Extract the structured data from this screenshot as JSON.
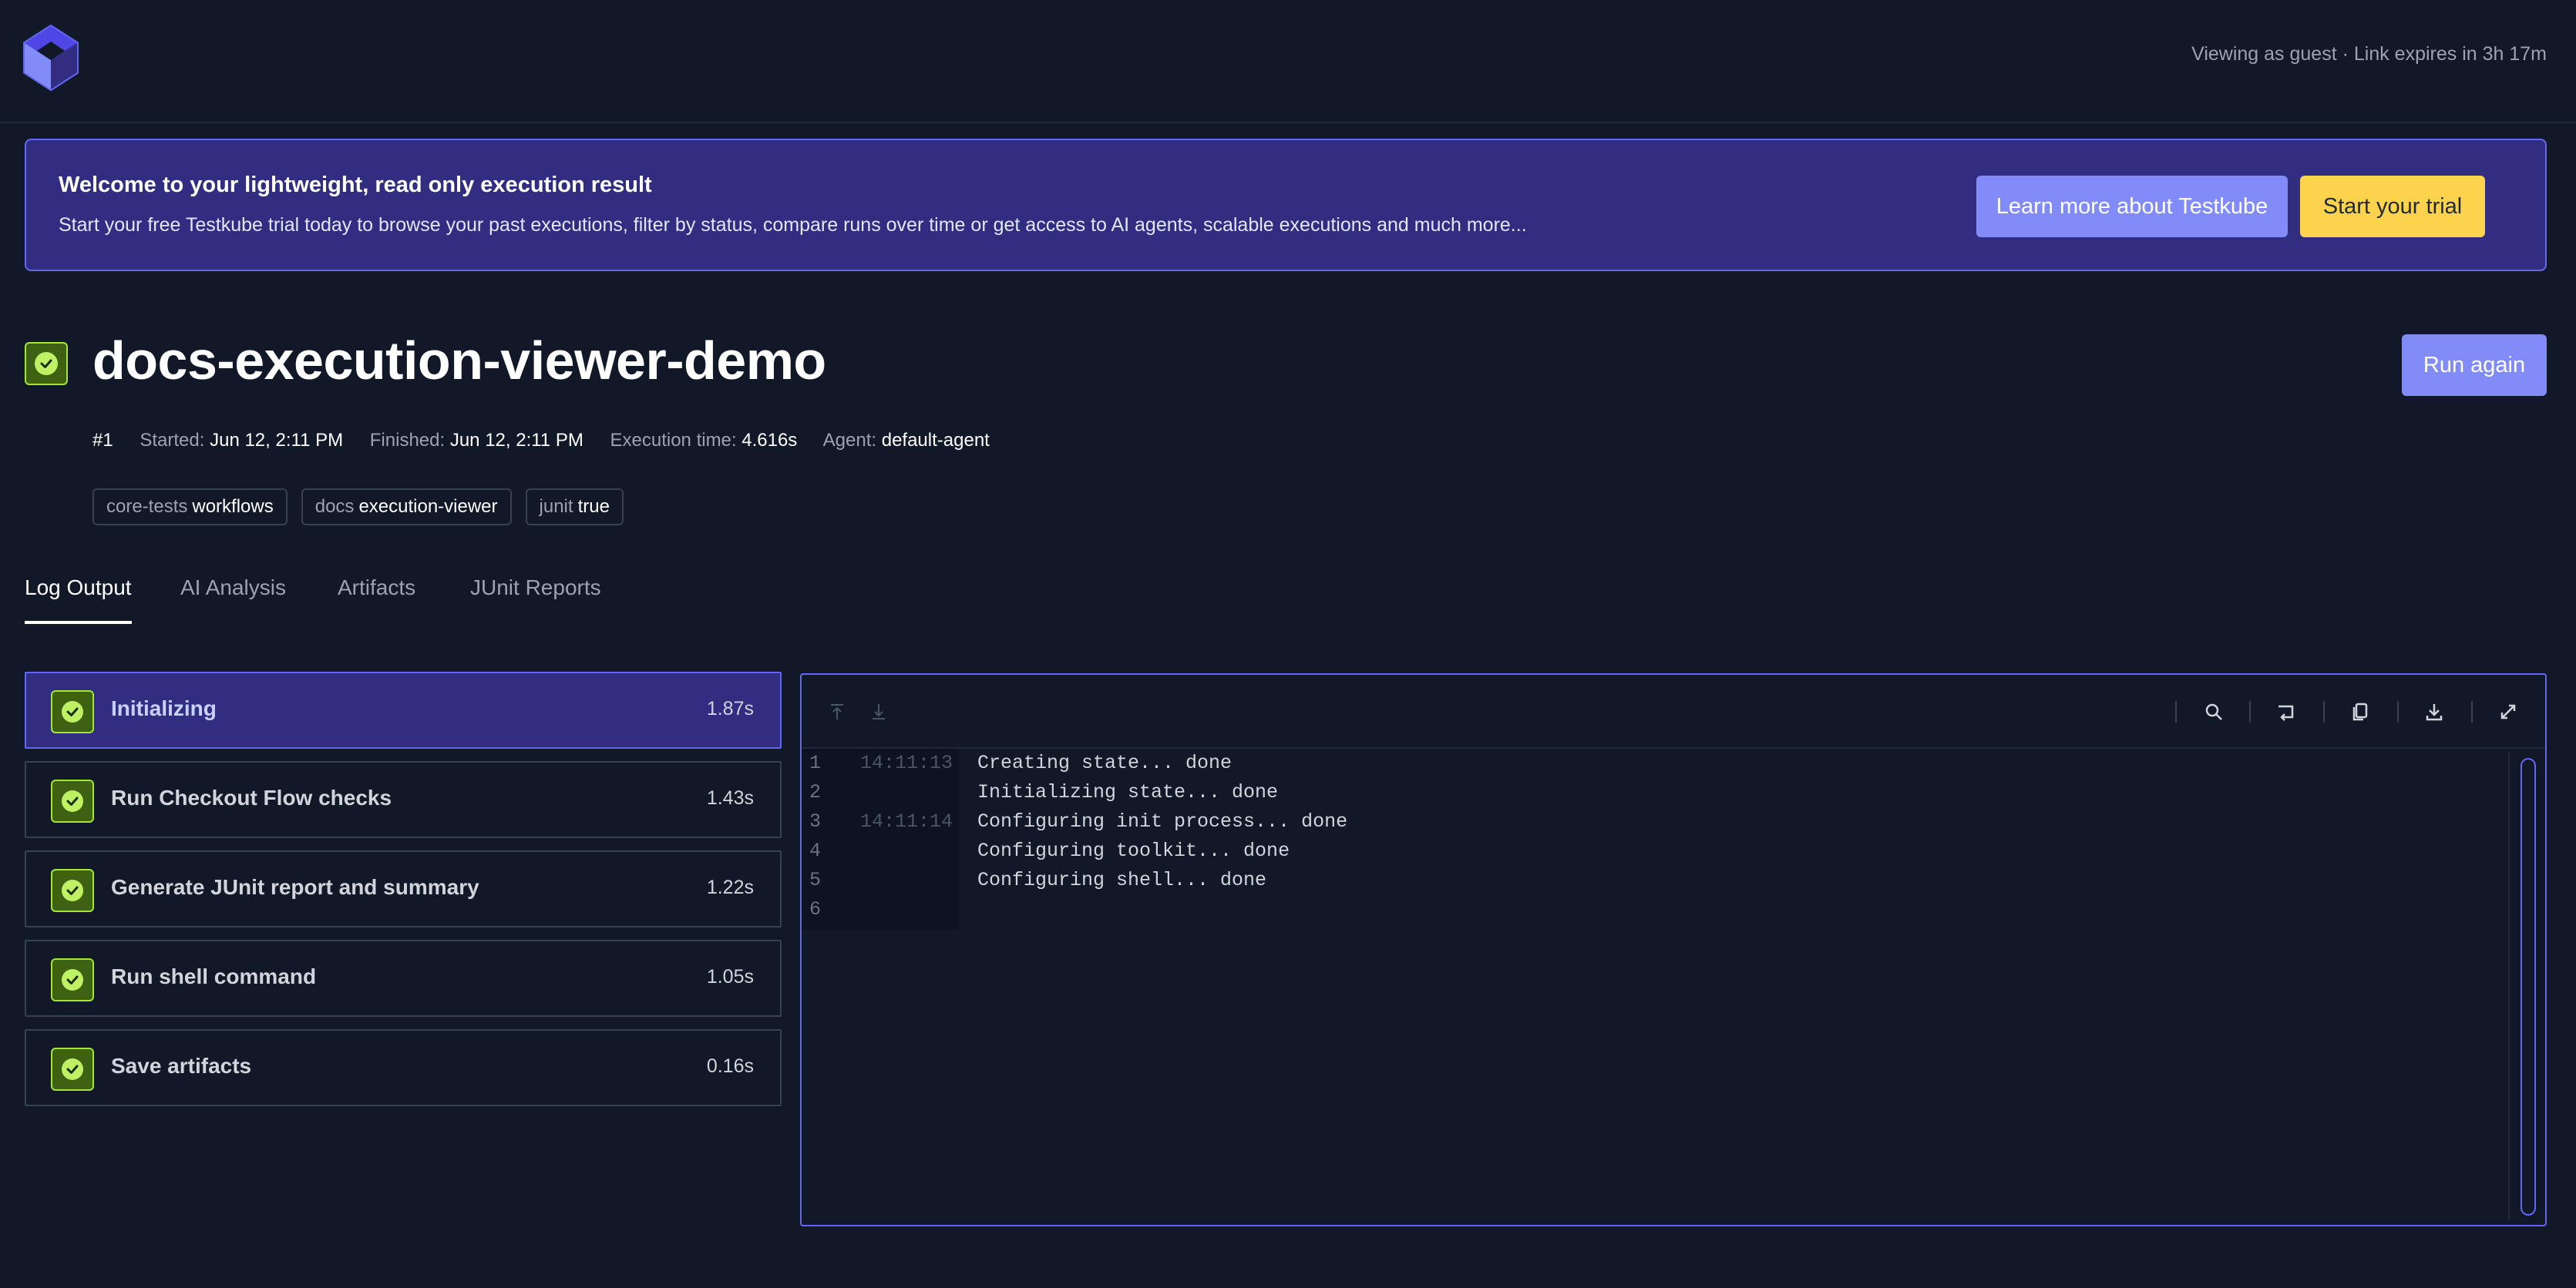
{
  "header": {
    "logo": "testkube-cube-logo",
    "guest_note": "Viewing as guest · Link expires in 3h 17m"
  },
  "banner": {
    "title": "Welcome to your lightweight, read only execution result",
    "description": "Start your free Testkube trial today to browse your past executions, filter by status, compare runs over time or get access to AI agents, scalable executions and much more...",
    "learn_more_label": "Learn more about Testkube",
    "trial_label": "Start your trial"
  },
  "execution": {
    "status": "passed",
    "status_color": "#a3e635",
    "name": "docs-execution-viewer-demo",
    "run_again_label": "Run again",
    "number": "#1",
    "started_label": "Started:",
    "started": "Jun 12, 2:11 PM",
    "finished_label": "Finished:",
    "finished": "Jun 12, 2:11 PM",
    "duration_label": "Execution time:",
    "duration": "4.616s",
    "agent_label": "Agent:",
    "agent": "default-agent"
  },
  "tags": [
    {
      "key": "core-tests",
      "value": "workflows"
    },
    {
      "key": "docs",
      "value": "execution-viewer"
    },
    {
      "key": "junit",
      "value": "true"
    }
  ],
  "tabs": [
    {
      "label": "Log Output",
      "active": true
    },
    {
      "label": "AI Analysis",
      "active": false
    },
    {
      "label": "Artifacts",
      "active": false
    },
    {
      "label": "JUnit Reports",
      "active": false
    }
  ],
  "steps": [
    {
      "name": "Initializing",
      "time": "1.87s",
      "active": true
    },
    {
      "name": "Run Checkout Flow checks",
      "time": "1.43s",
      "active": false
    },
    {
      "name": "Generate JUnit report and summary",
      "time": "1.22s",
      "active": false
    },
    {
      "name": "Run shell command",
      "time": "1.05s",
      "active": false
    },
    {
      "name": "Save artifacts",
      "time": "0.16s",
      "active": false
    }
  ],
  "log": {
    "toolbar_icons": [
      "scroll-top-icon",
      "scroll-bottom-icon",
      "search-icon",
      "wrap-icon",
      "copy-icon",
      "download-icon",
      "fullscreen-icon"
    ],
    "lines": [
      {
        "n": "1",
        "ts": "14:11:13",
        "text": "Creating state... done"
      },
      {
        "n": "2",
        "ts": "",
        "text": "Initializing state... done"
      },
      {
        "n": "3",
        "ts": "14:11:14",
        "text": "Configuring init process... done"
      },
      {
        "n": "4",
        "ts": "",
        "text": "Configuring toolkit... done"
      },
      {
        "n": "5",
        "ts": "",
        "text": "Configuring shell... done"
      },
      {
        "n": "6",
        "ts": "",
        "text": ""
      }
    ]
  },
  "colors": {
    "background": "#111827",
    "accent": "#818cf8",
    "banner": "#312e81",
    "trial_button": "#fcd34d",
    "success": "#a3e635"
  }
}
